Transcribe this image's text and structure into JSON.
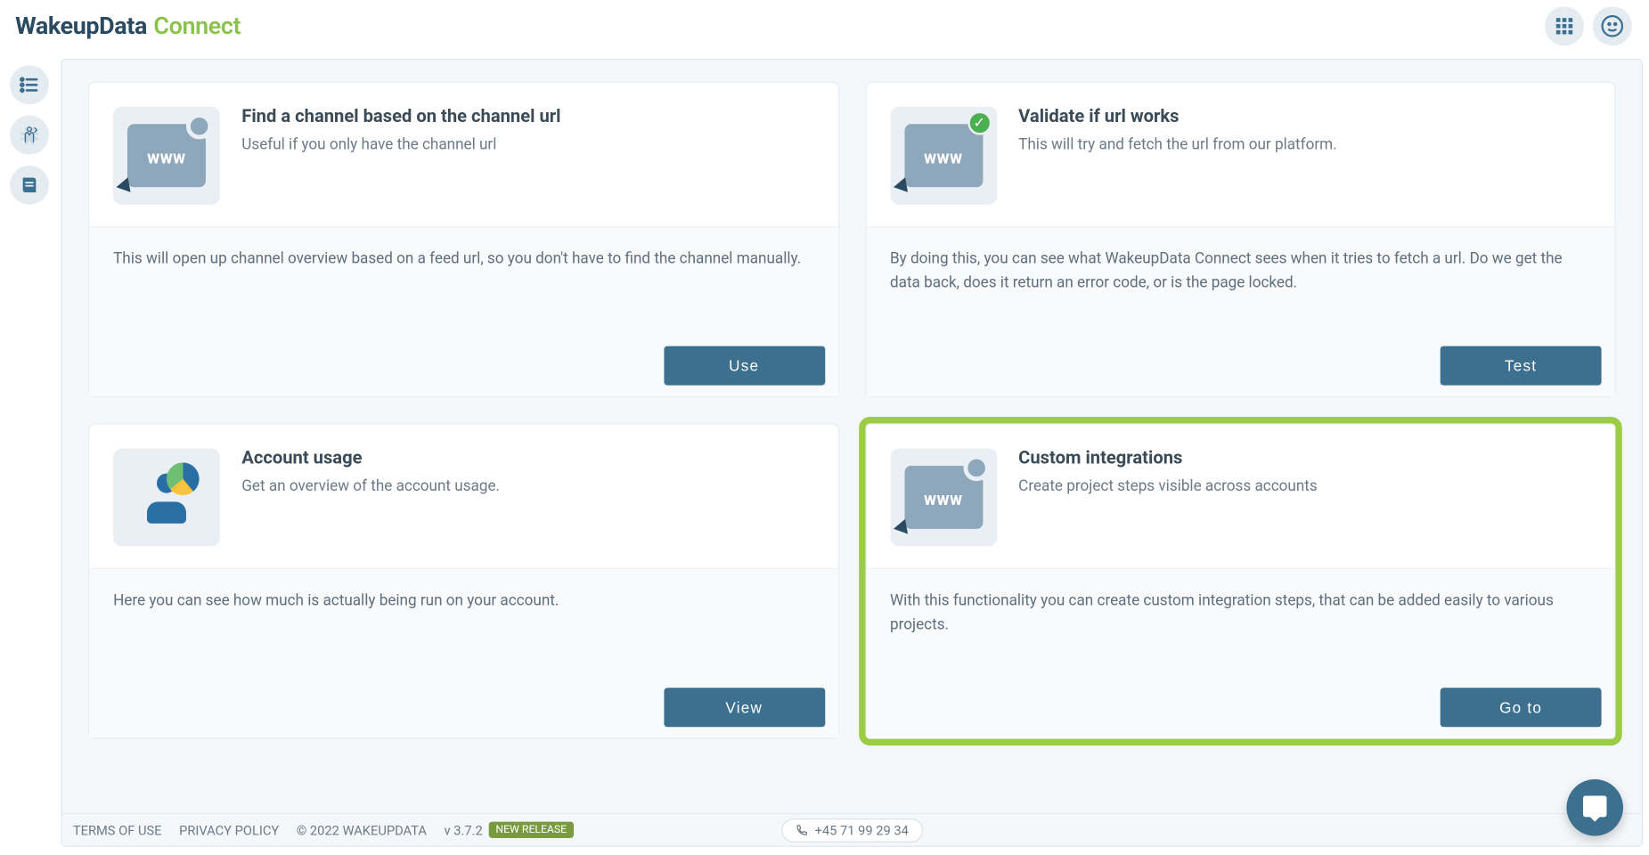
{
  "app": {
    "name1": "WakeupData",
    "name2": "Connect"
  },
  "cards": [
    {
      "title": "Find a channel based on the channel url",
      "sub": "Useful if you only have the channel url",
      "body": "This will open up channel overview based on a feed url, so you don't have to find the channel manually.",
      "btn": "Use",
      "icon": "www-search"
    },
    {
      "title": "Validate if url works",
      "sub": "This will try and fetch the url from our platform.",
      "body": "By doing this, you can see what WakeupData Connect sees when it tries to fetch a url. Do we get the data back, does it return an error code, or is the page locked.",
      "btn": "Test",
      "icon": "www-check"
    },
    {
      "title": "Account usage",
      "sub": "Get an overview of the account usage.",
      "body": "Here you can see how much is actually being run on your account.",
      "btn": "View",
      "icon": "usage-pie"
    },
    {
      "title": "Custom integrations",
      "sub": "Create project steps visible across accounts",
      "body": "With this functionality you can create custom integration steps, that can be added easily to various projects.",
      "btn": "Go to",
      "icon": "www-search",
      "highlight": true
    }
  ],
  "footer": {
    "terms": "TERMS OF USE",
    "privacy": "PRIVACY POLICY",
    "copyright": "© 2022 WAKEUPDATA",
    "version": "v 3.7.2",
    "badge": "NEW RELEASE",
    "phone": "+45 71 99 29 34"
  }
}
